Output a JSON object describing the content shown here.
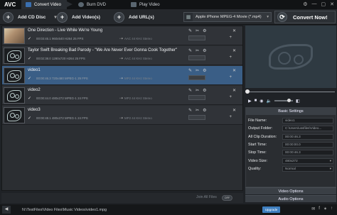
{
  "app": {
    "logo": "AVC"
  },
  "tabs": [
    {
      "label": "Convert Video",
      "color": "#3a6fb0"
    },
    {
      "label": "Burn DVD",
      "color": "#5a6670"
    },
    {
      "label": "Play Video",
      "color": "#5a6670"
    }
  ],
  "window_controls": [
    "⚙",
    "—",
    "▢",
    "✕"
  ],
  "toolbar": {
    "add_cd": "Add CD Disc",
    "add_cd_arrow": "▾",
    "add_videos": "Add Video(s)",
    "add_urls": "Add URL(s)",
    "profile": "Apple iPhone MPEG-4 Movie (*.mp4)",
    "profile_arrow": "▾",
    "convert": "Convert Now!"
  },
  "files": [
    {
      "title": "One Direction - Live While We're Young",
      "meta": "00:03:45.1   960x540   H264   25 FPS",
      "meta2": "AAC  44 KHz  Stereo",
      "selected": false,
      "photo": true
    },
    {
      "title": "Taylor Swift  Breaking Bad Parody - \"We Are Never Ever Gonna Cook Together\"",
      "meta": "00:02:38.0   1280x720   H264   25 FPS",
      "meta2": "AAC  44 KHz  Stereo",
      "selected": false,
      "photo": false
    },
    {
      "title": "video1",
      "meta": "00:00:46.3   720x480   MPEG-1   29 FPS",
      "meta2": "MP2  44 KHz  Stereo",
      "selected": true,
      "photo": false
    },
    {
      "title": "video2",
      "meta": "00:00:44.0   480x272   MPEG-1   24 FPS",
      "meta2": "MP2  44 KHz  Stereo",
      "selected": false,
      "photo": false
    },
    {
      "title": "video3",
      "meta": "00:00:48.1   480x272   MPEG-1   24 FPS",
      "meta2": "MP2  44 KHz  Stereo",
      "selected": false,
      "photo": false
    }
  ],
  "row_icons": [
    "✎",
    "✂",
    "⚙"
  ],
  "row_close": "✕",
  "row_add": "+",
  "row_check": "✓",
  "row_arrow": "⇢",
  "settings": {
    "header": "Basic Settings",
    "rows": [
      {
        "key": "File Name:",
        "value": "video1",
        "dropdown": false
      },
      {
        "key": "Output Folder:",
        "value": "C:\\Users\\ussfiles\\Video...",
        "dropdown": false
      },
      {
        "key": "All Clip Duration:",
        "value": "00:00:46.3",
        "dropdown": false
      },
      {
        "key": "Start Time:",
        "value": "00:00:00.0",
        "dropdown": false
      },
      {
        "key": "Stop Time:",
        "value": "00:00:46.3",
        "dropdown": false
      },
      {
        "key": "Video Size:",
        "value": "480x272",
        "dropdown": true
      },
      {
        "key": "Quality:",
        "value": "Normal",
        "dropdown": true
      }
    ]
  },
  "video_options": "Video Options",
  "audio_options": "Audio Options",
  "join_label": "Join All Files",
  "join_toggle": "OFF",
  "status": {
    "path": "N:\\TestFiles\\Video Files\\Music Videos\\video1.mpg",
    "upgrade": "Upgrade",
    "up_icon": "◀"
  },
  "status_icons": [
    "✉",
    "f",
    "✶",
    "↑"
  ],
  "player": {
    "controls": [
      "▶",
      "■",
      "◉",
      "◧"
    ],
    "speaker": "🔈"
  }
}
